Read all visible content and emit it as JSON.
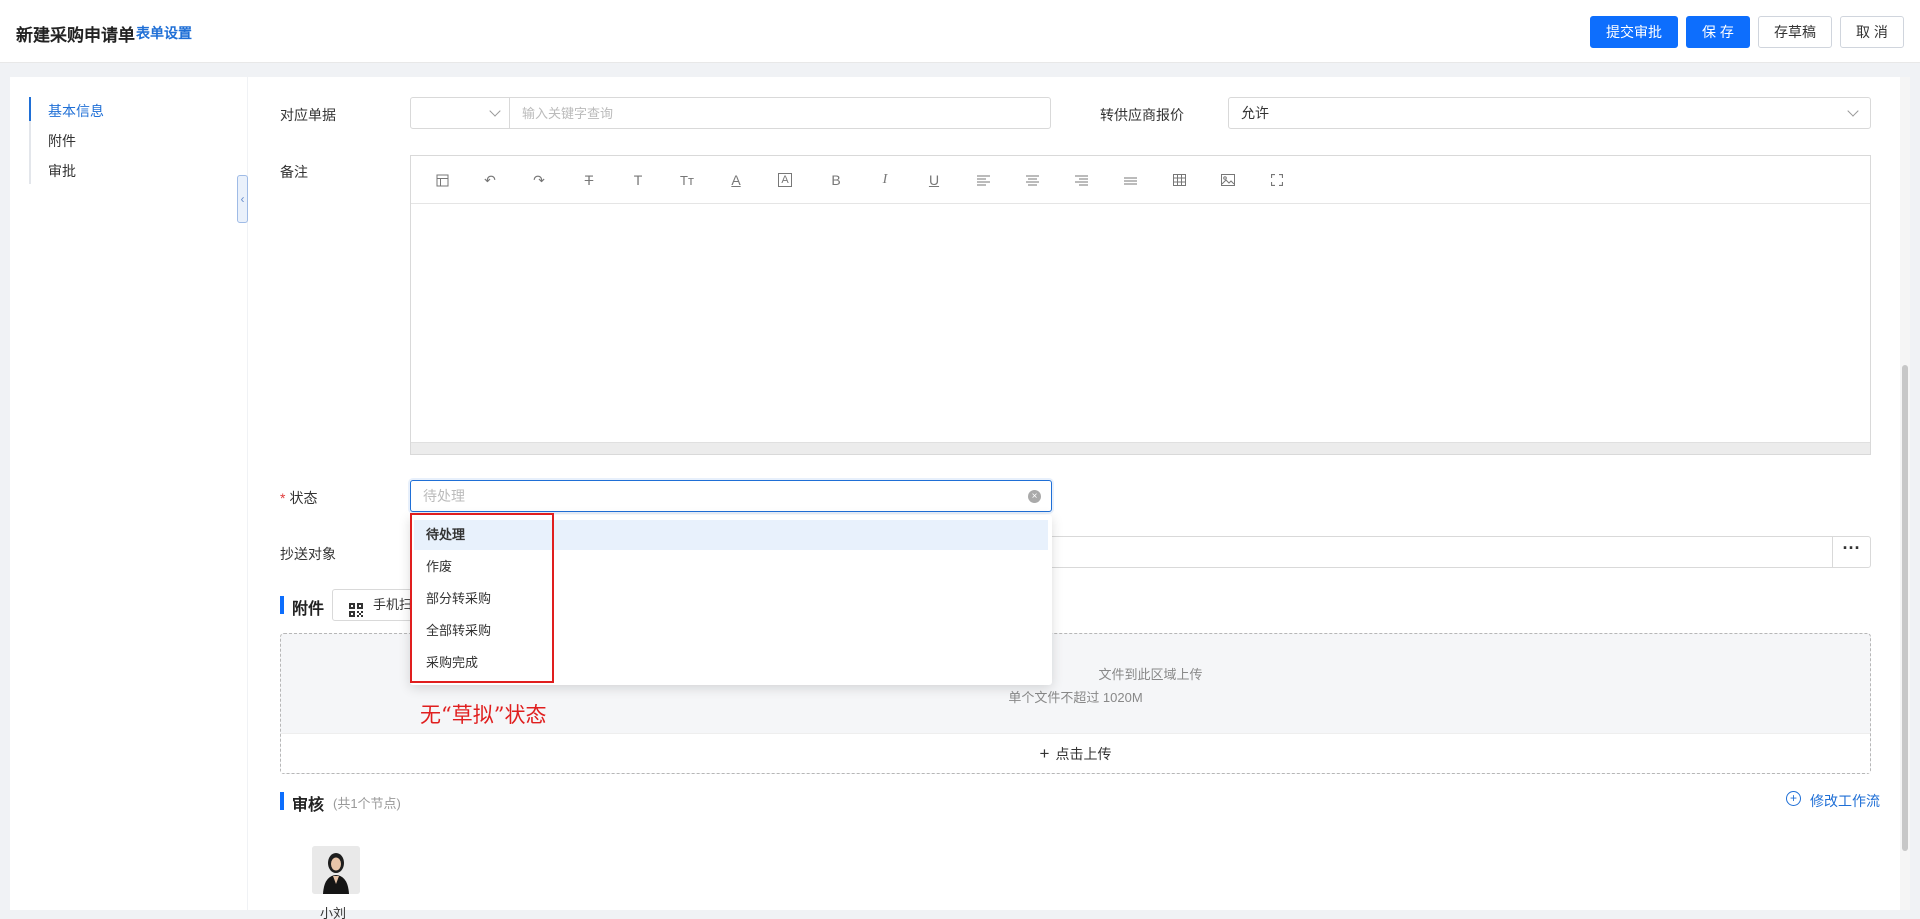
{
  "header": {
    "title": "新建采购申请单",
    "form_settings": "表单设置",
    "buttons": {
      "submit_approval": "提交审批",
      "save": "保 存",
      "save_draft": "存草稿",
      "cancel": "取 消"
    }
  },
  "sidebar": {
    "items": [
      {
        "label": "基本信息",
        "active": true
      },
      {
        "label": "附件",
        "active": false
      },
      {
        "label": "审批",
        "active": false
      }
    ]
  },
  "form": {
    "related_doc": {
      "label": "对应单据",
      "placeholder": "输入关键字查询"
    },
    "supplier_quote": {
      "label": "转供应商报价",
      "value": "允许"
    },
    "remarks": {
      "label": "备注"
    },
    "status": {
      "label": "状态",
      "placeholder": "待处理"
    },
    "cc": {
      "label": "抄送对象",
      "button": "···"
    }
  },
  "status_dropdown": {
    "options": [
      "待处理",
      "作废",
      "部分转采购",
      "全部转采购",
      "采购完成"
    ],
    "selected": "待处理"
  },
  "annotation": {
    "note": "无“草拟”状态",
    "color": "#e01e1e"
  },
  "attachments": {
    "title": "附件",
    "mobile_button": "手机扫",
    "drag_hint": "文件到此区域上传",
    "limit": "单个文件不超过 1020M",
    "upload_button": "点击上传"
  },
  "review": {
    "title": "审核",
    "subtitle": "(共1个节点)",
    "modify_workflow": "修改工作流",
    "approver_name": "小刘"
  },
  "colors": {
    "primary": "#0d6efd",
    "link": "#1f6fd6",
    "required": "#e03c3c"
  }
}
